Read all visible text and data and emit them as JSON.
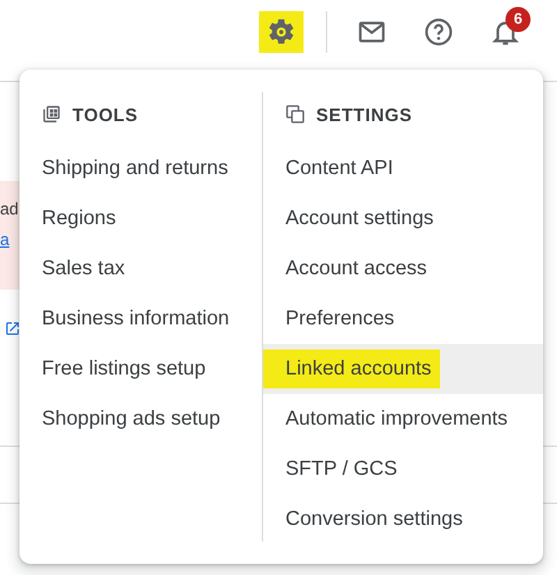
{
  "toolbar": {
    "settings_highlighted": true,
    "notification_count": "6"
  },
  "background": {
    "banner_text": "ad",
    "banner_link": "a"
  },
  "menu": {
    "columns": [
      {
        "kind": "tools",
        "title": "TOOLS",
        "items": [
          {
            "label": "Shipping and returns",
            "selected": false,
            "highlighted": false
          },
          {
            "label": "Regions",
            "selected": false,
            "highlighted": false
          },
          {
            "label": "Sales tax",
            "selected": false,
            "highlighted": false
          },
          {
            "label": "Business information",
            "selected": false,
            "highlighted": false
          },
          {
            "label": "Free listings setup",
            "selected": false,
            "highlighted": false
          },
          {
            "label": "Shopping ads setup",
            "selected": false,
            "highlighted": false
          }
        ]
      },
      {
        "kind": "settings",
        "title": "SETTINGS",
        "items": [
          {
            "label": "Content API",
            "selected": false,
            "highlighted": false
          },
          {
            "label": "Account settings",
            "selected": false,
            "highlighted": false
          },
          {
            "label": "Account access",
            "selected": false,
            "highlighted": false
          },
          {
            "label": "Preferences",
            "selected": false,
            "highlighted": false
          },
          {
            "label": "Linked accounts",
            "selected": true,
            "highlighted": true
          },
          {
            "label": "Automatic improvements",
            "selected": false,
            "highlighted": false
          },
          {
            "label": "SFTP / GCS",
            "selected": false,
            "highlighted": false
          },
          {
            "label": "Conversion settings",
            "selected": false,
            "highlighted": false
          }
        ]
      }
    ]
  }
}
